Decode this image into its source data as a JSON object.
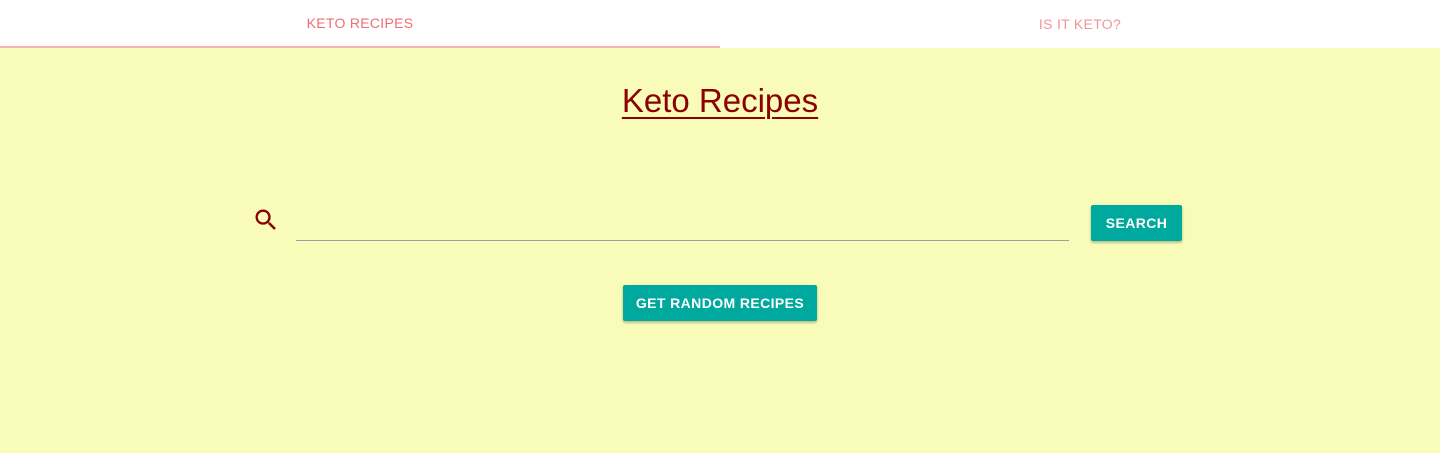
{
  "tabs": [
    {
      "label": "KETO RECIPES",
      "active": true
    },
    {
      "label": "IS IT KETO?",
      "active": false
    }
  ],
  "main": {
    "title": "Keto Recipes",
    "search": {
      "value": "",
      "placeholder": "",
      "icon": "search-icon",
      "button_label": "SEARCH"
    },
    "random_button_label": "GET RANDOM RECIPES"
  },
  "colors": {
    "background": "#f8fcb8",
    "accent": "#00a99d",
    "title": "#8b0000",
    "tab_active": "#ee6e73",
    "tab_indicator": "#f6b2b5"
  }
}
